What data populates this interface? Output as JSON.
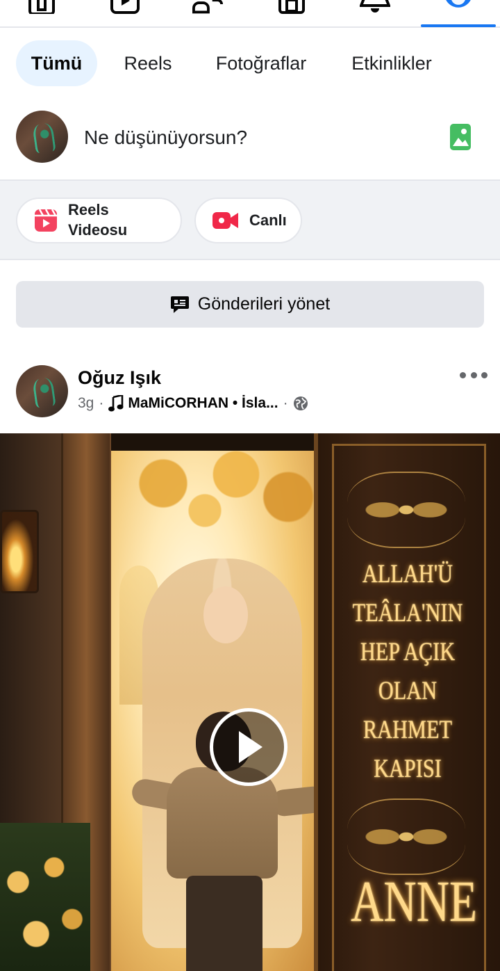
{
  "topnav": {
    "icons": [
      "home-icon",
      "video-icon",
      "friends-icon",
      "marketplace-icon",
      "notifications-icon",
      "profile-icon"
    ],
    "active": "profile-icon",
    "accent_color": "#1877f2"
  },
  "filters": {
    "tabs": [
      {
        "label": "Tümü",
        "active": true
      },
      {
        "label": "Reels",
        "active": false
      },
      {
        "label": "Fotoğraflar",
        "active": false
      },
      {
        "label": "Etkinlikler",
        "active": false
      }
    ]
  },
  "composer": {
    "placeholder": "Ne düşünüyorsun?",
    "photo_icon": "photo-icon",
    "photo_icon_color": "#45bd62"
  },
  "actions": {
    "reels_label_line1": "Reels",
    "reels_label_line2": "Videosu",
    "live_label": "Canlı",
    "reels_icon_color": "#f3425f",
    "live_icon_color": "#f02849"
  },
  "manage": {
    "label": "Gönderileri yönet"
  },
  "post": {
    "author": "Oğuz Işık",
    "time": "3g",
    "separator": "·",
    "audio": "MaMiCORHAN • İsla...",
    "privacy_icon": "globe-icon",
    "media": {
      "door_lines": [
        "ALLAH'Ü",
        "TEÂLA'NIN",
        "HEP AÇIK",
        "OLAN",
        "RAHMET",
        "KAPISI"
      ],
      "door_big": "ANNE",
      "type": "video"
    }
  }
}
